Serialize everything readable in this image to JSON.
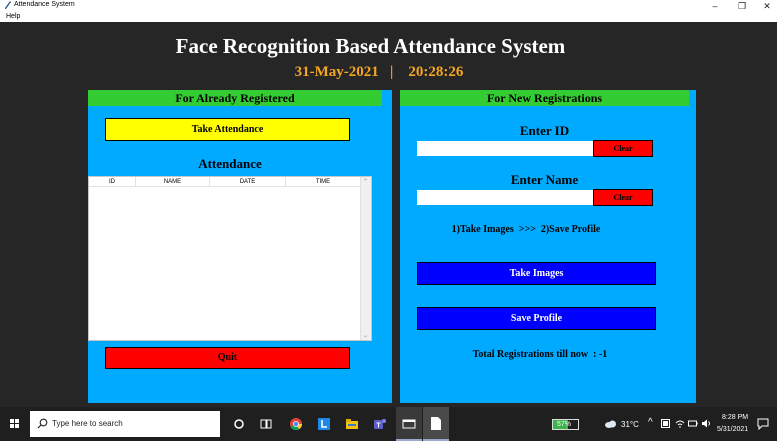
{
  "window": {
    "title": "Attendance System",
    "menu_help": "Help"
  },
  "heading": {
    "title": "Face Recognition Based Attendance System",
    "date": "31-May-2021",
    "separator": "|",
    "time": "20:28:26"
  },
  "left_panel": {
    "header": "For Already Registered",
    "take_attendance_label": "Take Attendance",
    "attendance_title": "Attendance",
    "columns": [
      "ID",
      "NAME",
      "DATE",
      "TIME"
    ],
    "quit_label": "Quit"
  },
  "right_panel": {
    "header": "For New Registrations",
    "enter_id_label": "Enter ID",
    "id_value": "",
    "clear_label": "Clear",
    "enter_name_label": "Enter Name",
    "name_value": "",
    "instruction": "1)Take Images  >>>  2)Save Profile",
    "take_images_label": "Take Images",
    "save_profile_label": "Save Profile",
    "total_registrations": "Total Registrations till now  : -1"
  },
  "taskbar": {
    "search_placeholder": "Type here to search",
    "battery": "57%",
    "temperature": "31°C",
    "clock_time": "8:28 PM",
    "clock_date": "5/31/2021"
  },
  "colors": {
    "window_bg": "#262626",
    "panel_bg": "#00aaff",
    "panel_header": "#33cc33",
    "date_text": "#f5a623",
    "take_attendance_btn": "#ffff00",
    "quit_btn": "#ff0000",
    "clear_btn": "#ff0000",
    "blue_btn": "#0000ff"
  }
}
